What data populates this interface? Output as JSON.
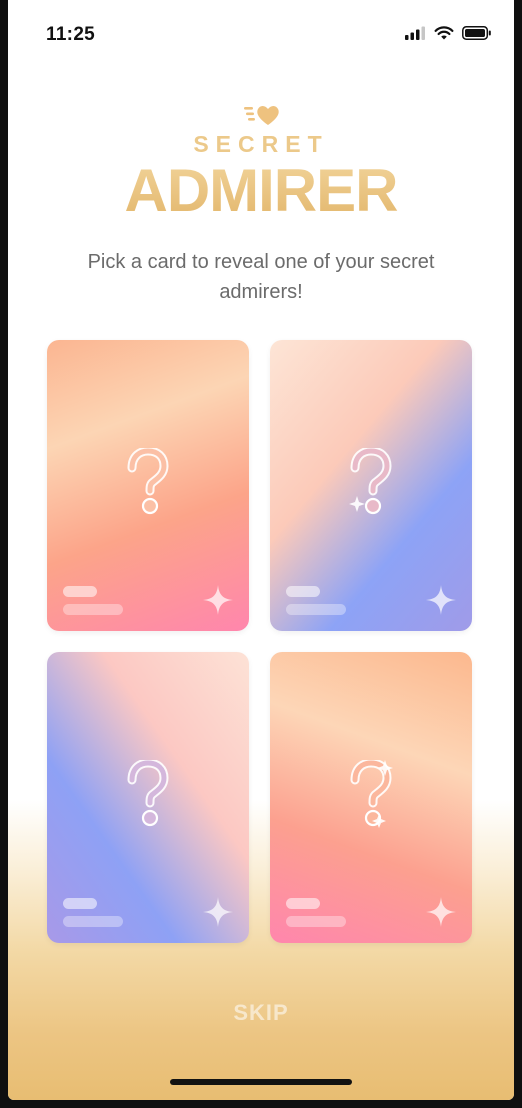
{
  "status_bar": {
    "time": "11:25"
  },
  "header": {
    "title_small": "SECRET",
    "title_big": "ADMIRER",
    "subtitle": "Pick a card to reveal one of your secret admirers!",
    "logo_icon": "flying-heart-icon",
    "accent_color": "#e9c37f"
  },
  "cards": [
    {
      "icon": "question-mark-icon"
    },
    {
      "icon": "question-mark-icon"
    },
    {
      "icon": "question-mark-icon"
    },
    {
      "icon": "question-mark-icon"
    }
  ],
  "footer": {
    "skip_label": "SKIP"
  }
}
